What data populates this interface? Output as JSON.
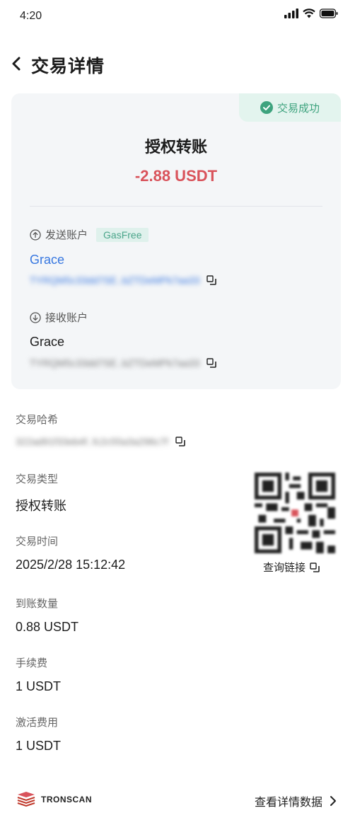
{
  "status_bar": {
    "time": "4:20"
  },
  "header": {
    "title": "交易详情"
  },
  "card": {
    "status": "交易成功",
    "tx_type": "授权转账",
    "amount": "-2.88 USDT",
    "sender": {
      "label": "发送账户",
      "badge": "GasFree",
      "name": "Grace",
      "address": "TYRQM5c33dd7SE..bZTDeMPk7aa33"
    },
    "receiver": {
      "label": "接收账户",
      "name": "Grace",
      "address": "TYRQM5c33dd7SE..bZTDeMPk7aa33"
    }
  },
  "details": {
    "hash_label": "交易哈希",
    "hash_value": "322ad91f33eb4f..fc2c55a3a296c7f",
    "type_label": "交易类型",
    "type_value": "授权转账",
    "time_label": "交易时间",
    "time_value": "2025/2/28 15:12:42",
    "received_label": "到账数量",
    "received_value": "0.88 USDT",
    "fee_label": "手续费",
    "fee_value": "1 USDT",
    "activation_label": "激活费用",
    "activation_value": "1 USDT"
  },
  "qr": {
    "link_label": "查询链接"
  },
  "footer": {
    "brand": "TRONSCAN",
    "details_link": "查看详情数据"
  },
  "colors": {
    "accent_red": "#d9535b",
    "link_blue": "#3777e0",
    "success_green": "#3ea37e"
  }
}
